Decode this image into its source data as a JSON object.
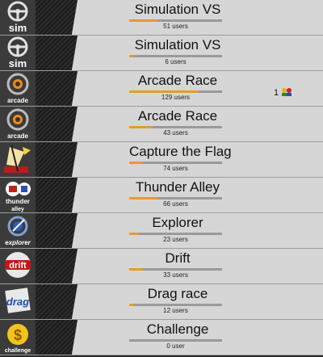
{
  "rows": [
    {
      "name": "Simulation VS",
      "users": "51 users",
      "fill": 0.3,
      "icon": "sim",
      "logo_text": "sim"
    },
    {
      "name": "Simulation VS",
      "users": "6 users",
      "fill": 0.05,
      "icon": "sim",
      "logo_text": "sim"
    },
    {
      "name": "Arcade Race",
      "users": "129 users",
      "fill": 0.75,
      "icon": "arcade",
      "logo_text": "arcade"
    },
    {
      "name": "Arcade Race",
      "users": "43 users",
      "fill": 0.25,
      "icon": "arcade",
      "logo_text": "arcade"
    },
    {
      "name": "Capture the Flag",
      "users": "74 users",
      "fill": 0.15,
      "icon": "ctf",
      "logo_text": ""
    },
    {
      "name": "Thunder Alley",
      "users": "66 users",
      "fill": 0.3,
      "icon": "thunder",
      "logo_text": "thunder alley"
    },
    {
      "name": "Explorer",
      "users": "23 users",
      "fill": 0.1,
      "icon": "explorer",
      "logo_text": "explorer"
    },
    {
      "name": "Drift",
      "users": "33 users",
      "fill": 0.15,
      "icon": "drift",
      "logo_text": "drift"
    },
    {
      "name": "Drag race",
      "users": "12 users",
      "fill": 0.05,
      "icon": "drag",
      "logo_text": "drag"
    },
    {
      "name": "Challenge",
      "users": "0 user",
      "fill": 0,
      "icon": "challenge",
      "logo_text": "challenge"
    }
  ],
  "friends_badge": {
    "row": 2,
    "count": "1"
  },
  "colors": {
    "fill": "#e69b2c",
    "track": "#9a9a9a",
    "row_bg": "#d6d6d6"
  }
}
